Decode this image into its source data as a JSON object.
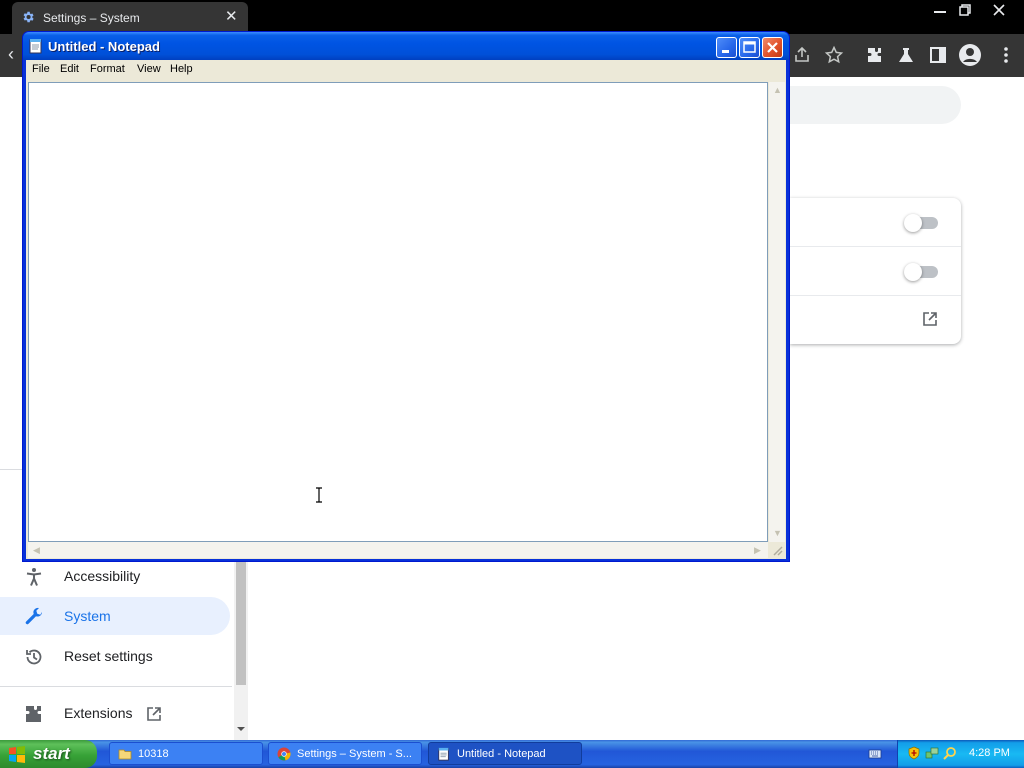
{
  "chrome": {
    "tab_title": "Settings – System",
    "tab_close": "✕",
    "back_glyph": "‹"
  },
  "settings": {
    "sidebar": [
      {
        "label": "Accessibility",
        "icon": "accessibility-icon"
      },
      {
        "label": "System",
        "icon": "wrench-icon",
        "selected": true
      },
      {
        "label": "Reset settings",
        "icon": "restore-icon"
      },
      {
        "label": "Extensions",
        "icon": "puzzle-icon",
        "external": true
      }
    ],
    "toggles": [
      {
        "on": false
      },
      {
        "on": false
      }
    ]
  },
  "notepad": {
    "title": "Untitled - Notepad",
    "menu": [
      "File",
      "Edit",
      "Format",
      "View",
      "Help"
    ],
    "content": ""
  },
  "taskbar": {
    "start_label": "start",
    "tasks": [
      {
        "label": "10318",
        "icon": "folder-icon",
        "active": false
      },
      {
        "label": "Settings – System - S...",
        "icon": "chrome-icon",
        "active": false
      },
      {
        "label": "Untitled - Notepad",
        "icon": "notepad-icon",
        "active": true
      }
    ],
    "clock": "4:28 PM"
  },
  "colors": {
    "xp_title_blue": "#0054e3",
    "chrome_dark": "#353535",
    "settings_accent": "#1a73e8"
  }
}
